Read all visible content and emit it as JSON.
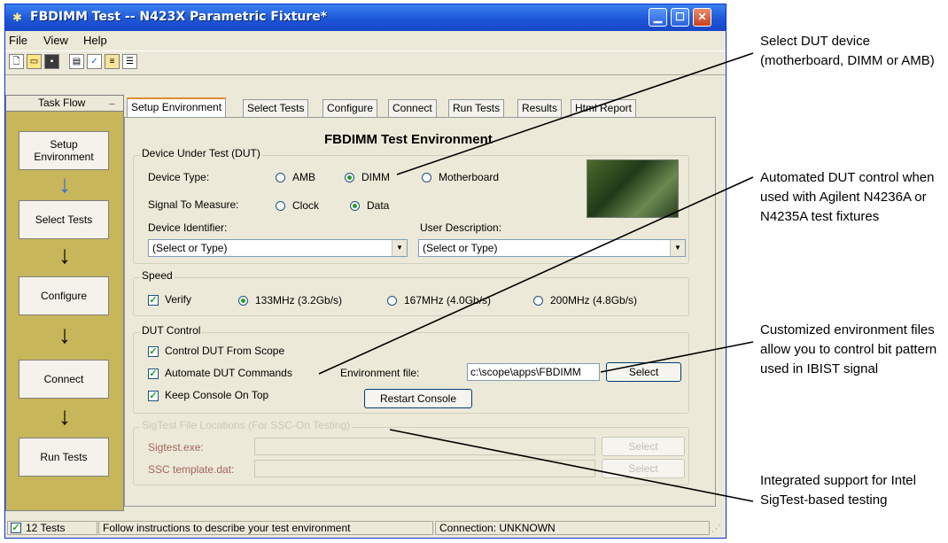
{
  "window": {
    "title": "FBDIMM Test -- N423X Parametric Fixture*"
  },
  "menu": [
    "File",
    "View",
    "Help"
  ],
  "toolbar_icons": [
    "new-file-icon",
    "open-folder-icon",
    "save-icon",
    "properties-icon",
    "run-check-icon",
    "tree-icon",
    "list-icon"
  ],
  "taskflow": {
    "header": "Task Flow",
    "minimize": "_",
    "steps": [
      "Setup\nEnvironment",
      "Select Tests",
      "Configure",
      "Connect",
      "Run Tests"
    ]
  },
  "tabs": [
    "Setup Environment",
    "Select Tests",
    "Configure",
    "Connect",
    "Run Tests",
    "Results",
    "Html Report"
  ],
  "panel": {
    "heading": "FBDIMM Test Environment",
    "dut": {
      "group_label": "Device Under Test (DUT)",
      "device_type_label": "Device Type:",
      "device_types": [
        "AMB",
        "DIMM",
        "Motherboard"
      ],
      "device_type_selected": "DIMM",
      "signal_label": "Signal To Measure:",
      "signals": [
        "Clock",
        "Data"
      ],
      "signal_selected": "Data",
      "identifier_label": "Device Identifier:",
      "identifier_value": "(Select or Type)",
      "description_label": "User Description:",
      "description_value": "(Select or Type)"
    },
    "speed": {
      "group_label": "Speed",
      "verify_label": "Verify",
      "verify_checked": true,
      "options": [
        "133MHz (3.2Gb/s)",
        "167MHz (4.0Gb/s)",
        "200MHz (4.8Gb/s)"
      ],
      "selected": "133MHz (3.2Gb/s)"
    },
    "dut_control": {
      "group_label": "DUT Control",
      "control_label": "Control DUT From Scope",
      "automate_label": "Automate DUT Commands",
      "console_label": "Keep Console On Top",
      "env_file_label": "Environment file:",
      "env_file_value": "c:\\scope\\apps\\FBDIMM",
      "select_button": "Select",
      "restart_button": "Restart Console"
    },
    "sigtest": {
      "group_label": "SigTest File Locations (For SSC-On Testing)",
      "sigtest_label": "Sigtest.exe:",
      "template_label": "SSC template.dat:",
      "select_button": "Select"
    }
  },
  "status": {
    "tests": "12 Tests",
    "message": "Follow instructions to describe your test environment",
    "connection": "Connection: UNKNOWN"
  },
  "callouts": [
    "Select DUT device (motherboard, DIMM or AMB)",
    "Automated DUT control when used with Agilent N4236A or N4235A test fixtures",
    "Customized environment files allow you to control bit pattern used in IBIST signal",
    "Integrated support for Intel SigTest-based testing"
  ]
}
